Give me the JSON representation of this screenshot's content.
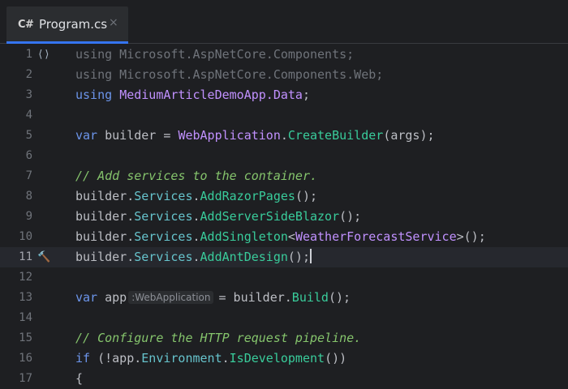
{
  "tab": {
    "icon_text": "C#",
    "label": "Program.cs",
    "close_glyph": "×",
    "icon": "csharp-file-icon"
  },
  "gutter": {
    "line1_icon": "⟨⟩",
    "line11_icon": "🔨"
  },
  "lines": [
    {
      "n": "1"
    },
    {
      "n": "2"
    },
    {
      "n": "3"
    },
    {
      "n": "4"
    },
    {
      "n": "5"
    },
    {
      "n": "6"
    },
    {
      "n": "7"
    },
    {
      "n": "8"
    },
    {
      "n": "9"
    },
    {
      "n": "10"
    },
    {
      "n": "11"
    },
    {
      "n": "12"
    },
    {
      "n": "13"
    },
    {
      "n": "14"
    },
    {
      "n": "15"
    },
    {
      "n": "16"
    },
    {
      "n": "17"
    }
  ],
  "code": {
    "l1": {
      "kw": "using",
      "ns": " Microsoft.AspNetCore.Components;"
    },
    "l2": {
      "kw": "using",
      "ns": " Microsoft.AspNetCore.Components.Web;"
    },
    "l3": {
      "kw": "using",
      "ns": "MediumArticleDemoApp.Data",
      "end": ";"
    },
    "l5": {
      "kw": "var",
      "ident": " builder = ",
      "type": "WebApplication",
      "dot": ".",
      "meth": "CreateBuilder",
      "end": "(args);"
    },
    "l7": {
      "comment": "// Add services to the container."
    },
    "l8": {
      "a": "builder.",
      "prop": "Services",
      "dot": ".",
      "meth": "AddRazorPages",
      "end": "();"
    },
    "l9": {
      "a": "builder.",
      "prop": "Services",
      "dot": ".",
      "meth": "AddServerSideBlazor",
      "end": "();"
    },
    "l10": {
      "a": "builder.",
      "prop": "Services",
      "dot": ".",
      "meth": "AddSingleton",
      "lt": "<",
      "type": "WeatherForecastService",
      "end": ">();"
    },
    "l11": {
      "a": "builder.",
      "prop": "Services",
      "dot": ".",
      "meth": "AddAntDesign",
      "end": "();"
    },
    "l13": {
      "kw": "var",
      "ident": " app",
      "hint": ":WebApplication",
      "mid": "= builder.",
      "meth": "Build",
      "end": "();"
    },
    "l15": {
      "comment": "// Configure the HTTP request pipeline."
    },
    "l16": {
      "kw": "if",
      "a": " (!app.",
      "prop": "Environment",
      "dot": ".",
      "meth": "IsDevelopment",
      "end": "())"
    },
    "l17": {
      "a": "{"
    }
  },
  "colors": {
    "keyword": "#6c95eb",
    "type": "#c191ff",
    "method": "#39cc9b",
    "property": "#66c3cc",
    "comment": "#85c46c",
    "accent": "#3574f0"
  }
}
